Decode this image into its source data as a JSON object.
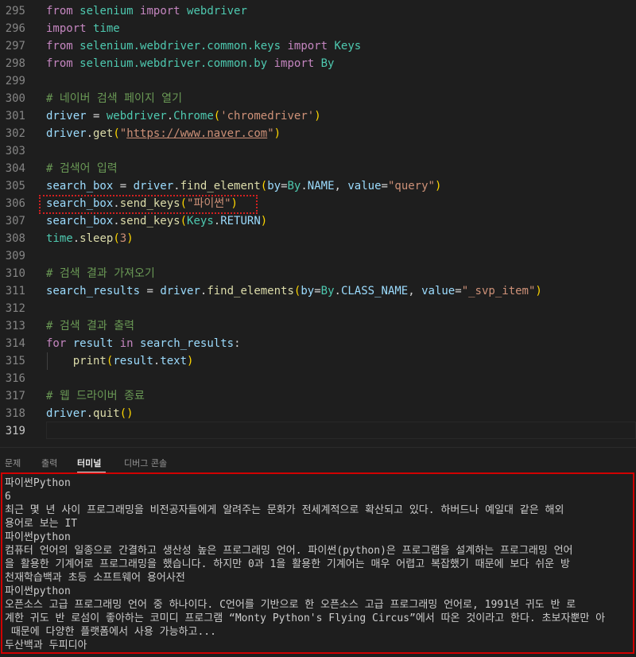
{
  "editor": {
    "lines": [
      {
        "num": "295",
        "tokens": [
          [
            "kw",
            "from"
          ],
          [
            "pl",
            " "
          ],
          [
            "mod",
            "selenium"
          ],
          [
            "pl",
            " "
          ],
          [
            "kw",
            "import"
          ],
          [
            "pl",
            " "
          ],
          [
            "mod",
            "webdriver"
          ]
        ]
      },
      {
        "num": "296",
        "tokens": [
          [
            "kw",
            "import"
          ],
          [
            "pl",
            " "
          ],
          [
            "mod",
            "time"
          ]
        ]
      },
      {
        "num": "297",
        "tokens": [
          [
            "kw",
            "from"
          ],
          [
            "pl",
            " "
          ],
          [
            "mod",
            "selenium.webdriver.common.keys"
          ],
          [
            "pl",
            " "
          ],
          [
            "kw",
            "import"
          ],
          [
            "pl",
            " "
          ],
          [
            "mod",
            "Keys"
          ]
        ]
      },
      {
        "num": "298",
        "tokens": [
          [
            "kw",
            "from"
          ],
          [
            "pl",
            " "
          ],
          [
            "mod",
            "selenium.webdriver.common.by"
          ],
          [
            "pl",
            " "
          ],
          [
            "kw",
            "import"
          ],
          [
            "pl",
            " "
          ],
          [
            "mod",
            "By"
          ]
        ]
      },
      {
        "num": "299",
        "tokens": []
      },
      {
        "num": "300",
        "tokens": [
          [
            "cm",
            "# 네이버 검색 페이지 열기"
          ]
        ]
      },
      {
        "num": "301",
        "tokens": [
          [
            "var",
            "driver"
          ],
          [
            "pl",
            " = "
          ],
          [
            "mod",
            "webdriver"
          ],
          [
            "pl",
            "."
          ],
          [
            "mod",
            "Chrome"
          ],
          [
            "br",
            "("
          ],
          [
            "str",
            "'chromedriver'"
          ],
          [
            "br",
            ")"
          ]
        ]
      },
      {
        "num": "302",
        "tokens": [
          [
            "var",
            "driver"
          ],
          [
            "pl",
            "."
          ],
          [
            "fn",
            "get"
          ],
          [
            "br",
            "("
          ],
          [
            "str",
            "\""
          ],
          [
            "url",
            "https://www.naver.com"
          ],
          [
            "str",
            "\""
          ],
          [
            "br",
            ")"
          ]
        ]
      },
      {
        "num": "303",
        "tokens": []
      },
      {
        "num": "304",
        "tokens": [
          [
            "cm",
            "# 검색어 입력"
          ]
        ]
      },
      {
        "num": "305",
        "tokens": [
          [
            "var",
            "search_box"
          ],
          [
            "pl",
            " = "
          ],
          [
            "var",
            "driver"
          ],
          [
            "pl",
            "."
          ],
          [
            "fn",
            "find_element"
          ],
          [
            "br",
            "("
          ],
          [
            "var",
            "by"
          ],
          [
            "pl",
            "="
          ],
          [
            "mod",
            "By"
          ],
          [
            "pl",
            "."
          ],
          [
            "var",
            "NAME"
          ],
          [
            "pl",
            ", "
          ],
          [
            "var",
            "value"
          ],
          [
            "pl",
            "="
          ],
          [
            "str",
            "\"query\""
          ],
          [
            "br",
            ")"
          ]
        ]
      },
      {
        "num": "306",
        "tokens": [
          [
            "var",
            "search_box"
          ],
          [
            "pl",
            "."
          ],
          [
            "fn",
            "send_keys"
          ],
          [
            "br",
            "("
          ],
          [
            "str",
            "\"파이썬\""
          ],
          [
            "br",
            ")"
          ]
        ]
      },
      {
        "num": "307",
        "tokens": [
          [
            "var",
            "search_box"
          ],
          [
            "pl",
            "."
          ],
          [
            "fn",
            "send_keys"
          ],
          [
            "br",
            "("
          ],
          [
            "mod",
            "Keys"
          ],
          [
            "pl",
            "."
          ],
          [
            "var",
            "RETURN"
          ],
          [
            "br",
            ")"
          ]
        ]
      },
      {
        "num": "308",
        "tokens": [
          [
            "mod",
            "time"
          ],
          [
            "pl",
            "."
          ],
          [
            "fn",
            "sleep"
          ],
          [
            "br",
            "("
          ],
          [
            "str",
            "3"
          ],
          [
            "br",
            ")"
          ]
        ]
      },
      {
        "num": "309",
        "tokens": []
      },
      {
        "num": "310",
        "tokens": [
          [
            "cm",
            "# 검색 결과 가져오기"
          ]
        ]
      },
      {
        "num": "311",
        "tokens": [
          [
            "var",
            "search_results"
          ],
          [
            "pl",
            " = "
          ],
          [
            "var",
            "driver"
          ],
          [
            "pl",
            "."
          ],
          [
            "fn",
            "find_elements"
          ],
          [
            "br",
            "("
          ],
          [
            "var",
            "by"
          ],
          [
            "pl",
            "="
          ],
          [
            "mod",
            "By"
          ],
          [
            "pl",
            "."
          ],
          [
            "var",
            "CLASS_NAME"
          ],
          [
            "pl",
            ", "
          ],
          [
            "var",
            "value"
          ],
          [
            "pl",
            "="
          ],
          [
            "str",
            "\"_svp_item\""
          ],
          [
            "br",
            ")"
          ]
        ]
      },
      {
        "num": "312",
        "tokens": []
      },
      {
        "num": "313",
        "tokens": [
          [
            "cm",
            "# 검색 결과 출력"
          ]
        ]
      },
      {
        "num": "314",
        "tokens": [
          [
            "kw",
            "for"
          ],
          [
            "pl",
            " "
          ],
          [
            "var",
            "result"
          ],
          [
            "pl",
            " "
          ],
          [
            "kw",
            "in"
          ],
          [
            "pl",
            " "
          ],
          [
            "var",
            "search_results"
          ],
          [
            "pl",
            ":"
          ]
        ]
      },
      {
        "num": "315",
        "tokens": [
          [
            "pl",
            "    "
          ],
          [
            "fn",
            "print"
          ],
          [
            "br",
            "("
          ],
          [
            "var",
            "result"
          ],
          [
            "pl",
            "."
          ],
          [
            "var",
            "text"
          ],
          [
            "br",
            ")"
          ]
        ]
      },
      {
        "num": "316",
        "tokens": []
      },
      {
        "num": "317",
        "tokens": [
          [
            "cm",
            "# 웹 드라이버 종료"
          ]
        ]
      },
      {
        "num": "318",
        "tokens": [
          [
            "var",
            "driver"
          ],
          [
            "pl",
            "."
          ],
          [
            "fn",
            "quit"
          ],
          [
            "br",
            "()"
          ]
        ]
      },
      {
        "num": "319",
        "tokens": []
      }
    ],
    "active_line": "319"
  },
  "panel": {
    "tabs": [
      "문제",
      "출력",
      "터미널",
      "디버그 콘솔"
    ],
    "active_tab": "터미널"
  },
  "terminal": {
    "lines": [
      "파이썬Python",
      "6",
      "최근 몇 년 사이 프로그래밍을 비전공자들에게 알려주는 문화가 전세계적으로 확산되고 있다. 하버드나 예일대 같은 해외",
      "용어로 보는 IT",
      "파이썬python",
      "컴퓨터 언어의 일종으로 간결하고 생산성 높은 프로그래밍 언어. 파이썬(python)은 프로그램을 설계하는 프로그래밍 언어",
      "을 활용한 기계어로 프로그래밍을 했습니다. 하지만 0과 1을 활용한 기계어는 매우 어렵고 복잡했기 때문에 보다 쉬운 방",
      "천재학습백과 초등 소프트웨어 용어사전",
      "파이썬python",
      "오픈소스 고급 프로그래밍 언어 중 하나이다. C언어를 기반으로 한 오픈소스 고급 프로그래밍 언어로, 1991년 귀도 반 로",
      "계한 귀도 반 로섬이 좋아하는 코미디 프로그램 “Monty Python's Flying Circus”에서 따온 것이라고 한다. 초보자뿐만 아",
      " 때문에 다양한 플랫폼에서 사용 가능하고...",
      "두산백과 두피디아"
    ]
  }
}
